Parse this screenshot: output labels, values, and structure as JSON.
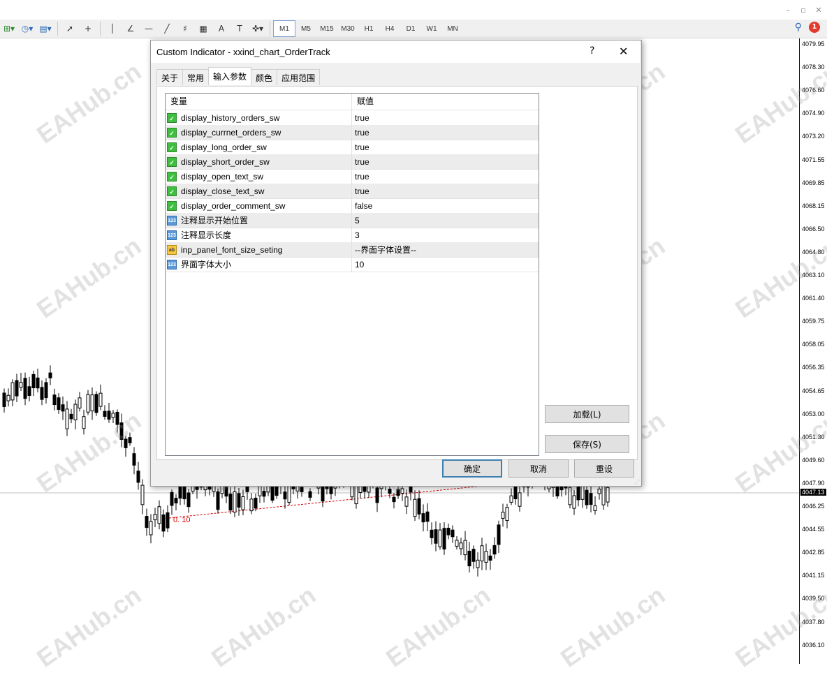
{
  "toolbar": {
    "timeframes": [
      "M1",
      "M5",
      "M15",
      "M30",
      "H1",
      "H4",
      "D1",
      "W1",
      "MN"
    ],
    "active_timeframe": "M1",
    "alert_count": "1"
  },
  "chart": {
    "prices": [
      "4079.95",
      "4078.30",
      "4076.60",
      "4074.90",
      "4073.20",
      "4071.55",
      "4069.85",
      "4068.15",
      "4066.50",
      "4064.80",
      "4063.10",
      "4061.40",
      "4059.75",
      "4058.05",
      "4056.35",
      "4054.65",
      "4053.00",
      "4051.30",
      "4049.60",
      "4047.90",
      "4046.25",
      "4044.55",
      "4042.85",
      "4041.15",
      "4039.50",
      "4037.80",
      "4036.10"
    ],
    "current_price": "4047.13",
    "order_label": "0. 10",
    "watermark": "EAHub.cn",
    "colors": {
      "order_line": "#d40000",
      "candle": "#000000"
    }
  },
  "dialog": {
    "title": "Custom Indicator - xxind_chart_OrderTrack",
    "help": "?",
    "close": "✕",
    "tabs": [
      "关于",
      "常用",
      "输入参数",
      "颜色",
      "应用范围"
    ],
    "active_tab": "输入参数",
    "grid": {
      "col_variable": "变量",
      "col_value": "赋值",
      "rows": [
        {
          "icon": "bool",
          "name": "display_history_orders_sw",
          "value": "true"
        },
        {
          "icon": "bool",
          "name": "display_currnet_orders_sw",
          "value": "true"
        },
        {
          "icon": "bool",
          "name": "display_long_order_sw",
          "value": "true"
        },
        {
          "icon": "bool",
          "name": "display_short_order_sw",
          "value": "true"
        },
        {
          "icon": "bool",
          "name": "display_open_text_sw",
          "value": "true"
        },
        {
          "icon": "bool",
          "name": "display_close_text_sw",
          "value": "true"
        },
        {
          "icon": "bool",
          "name": "display_order_comment_sw",
          "value": "false"
        },
        {
          "icon": "num",
          "name": "注释显示开始位置",
          "value": "5"
        },
        {
          "icon": "num",
          "name": "注释显示长度",
          "value": "3"
        },
        {
          "icon": "str",
          "name": "inp_panel_font_size_seting",
          "value": "--界面字体设置--"
        },
        {
          "icon": "num",
          "name": "界面字体大小",
          "value": "10"
        }
      ]
    },
    "buttons": {
      "load": "加载(L)",
      "save": "保存(S)",
      "ok": "确定",
      "cancel": "取消",
      "reset": "重设"
    }
  }
}
